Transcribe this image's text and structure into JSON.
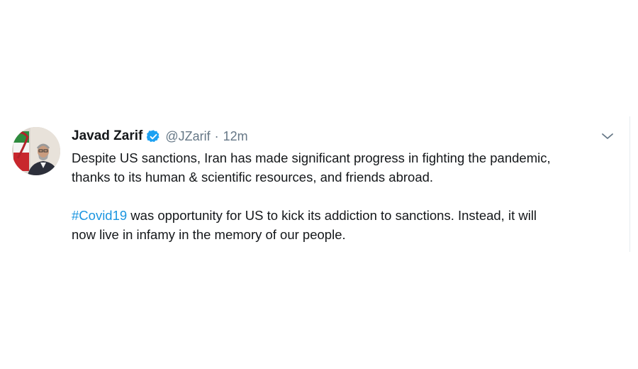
{
  "tweet": {
    "author_name": "Javad Zarif",
    "handle": "@JZarif",
    "separator": "·",
    "time": "12m",
    "verified_icon": "verified-badge-icon",
    "menu_icon": "chevron-down-icon",
    "line1": "Despite US sanctions, Iran has made significant progress in fighting the pandemic,",
    "line2": "thanks to its human & scientific resources, and friends abroad.",
    "hashtag": "#Covid19",
    "line3_rest": " was opportunity for US to kick its addiction to sanctions. Instead, it will",
    "line4": "now live in infamy in the memory of our people."
  },
  "colors": {
    "link": "#1b95e0",
    "verified": "#1da1f2",
    "secondary_text": "#657786",
    "primary_text": "#14171a"
  }
}
